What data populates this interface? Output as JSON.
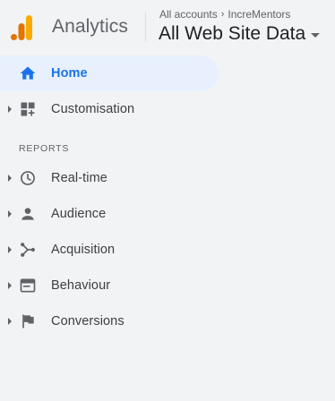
{
  "header": {
    "app_name": "Analytics",
    "breadcrumb": {
      "root": "All accounts",
      "separator": "›",
      "account": "IncreMentors"
    },
    "view_name": "All Web Site Data"
  },
  "nav": {
    "home": {
      "label": "Home",
      "icon": "home-icon",
      "active": true
    },
    "customisation": {
      "label": "Customisation",
      "icon": "dashboard-customise-icon"
    },
    "reports_header": "REPORTS",
    "reports": [
      {
        "label": "Real-time",
        "icon": "clock-icon"
      },
      {
        "label": "Audience",
        "icon": "person-icon"
      },
      {
        "label": "Acquisition",
        "icon": "acquisition-icon"
      },
      {
        "label": "Behaviour",
        "icon": "behaviour-icon"
      },
      {
        "label": "Conversions",
        "icon": "flag-icon"
      }
    ]
  },
  "colors": {
    "active_accent": "#1a73e8",
    "active_bg": "#e8f0fe",
    "logo_orange": "#f9ab00",
    "logo_dark_orange": "#e37400",
    "sidebar_bg": "#f1f3f4"
  }
}
